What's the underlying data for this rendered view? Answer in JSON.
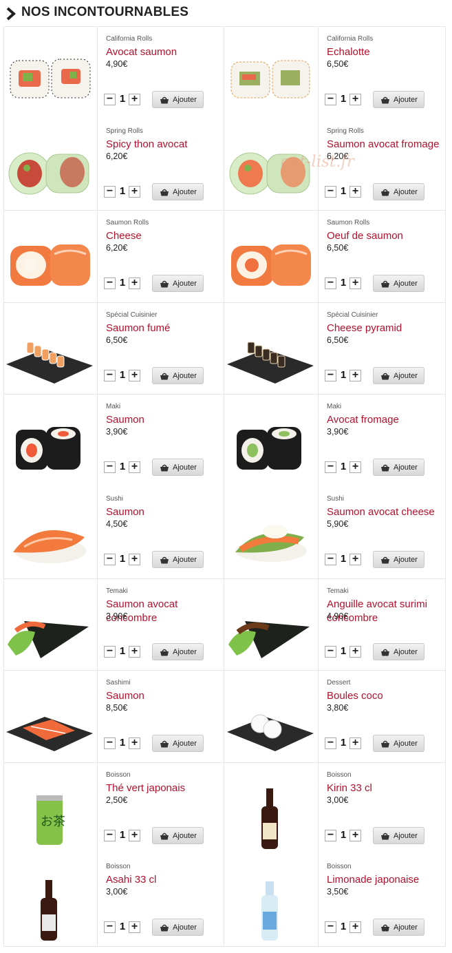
{
  "page": {
    "title": "NOS INCONTOURNABLES",
    "watermark": "eat-list.fr"
  },
  "add_label": "Ajouter",
  "products": [
    {
      "category": "California Rolls",
      "name": "Avocat saumon",
      "price": "4,90€",
      "qty": "1",
      "img": "california-roll-avocado-salmon"
    },
    {
      "category": "California Rolls",
      "name": "Echalotte",
      "price": "6,50€",
      "qty": "1",
      "img": "california-roll-shallot"
    },
    {
      "category": "Spring Rolls",
      "name": "Spicy thon avocat",
      "price": "6,20€",
      "qty": "1",
      "img": "spring-roll-tuna"
    },
    {
      "category": "Spring Rolls",
      "name": "Saumon avocat fromage",
      "price": "6,20€",
      "qty": "1",
      "img": "spring-roll-salmon"
    },
    {
      "category": "Saumon Rolls",
      "name": "Cheese",
      "price": "6,20€",
      "qty": "1",
      "img": "salmon-roll-cheese"
    },
    {
      "category": "Saumon Rolls",
      "name": "Oeuf de saumon",
      "price": "6,50€",
      "qty": "1",
      "img": "salmon-roll-roe"
    },
    {
      "category": "Spécial Cuisinier",
      "name": "Saumon fumé",
      "price": "6,50€",
      "qty": "1",
      "img": "plate-smoked-salmon-rolls"
    },
    {
      "category": "Spécial Cuisinier",
      "name": "Cheese pyramid",
      "price": "6,50€",
      "qty": "1",
      "img": "plate-cheese-pyramid"
    },
    {
      "category": "Maki",
      "name": "Saumon",
      "price": "3,90€",
      "qty": "1",
      "img": "maki-salmon"
    },
    {
      "category": "Maki",
      "name": "Avocat fromage",
      "price": "3,90€",
      "qty": "1",
      "img": "maki-avocado"
    },
    {
      "category": "Sushi",
      "name": "Saumon",
      "price": "4,50€",
      "qty": "1",
      "img": "sushi-salmon"
    },
    {
      "category": "Sushi",
      "name": "Saumon avocat cheese",
      "price": "5,90€",
      "qty": "1",
      "img": "sushi-salmon-avocado"
    },
    {
      "category": "Temaki",
      "name": "Saumon avocat concombre",
      "price": "3,90€",
      "qty": "1",
      "img": "temaki-salmon"
    },
    {
      "category": "Temaki",
      "name": "Anguille avocat surimi concombre",
      "price": "4,90€",
      "qty": "1",
      "img": "temaki-eel"
    },
    {
      "category": "Sashimi",
      "name": "Saumon",
      "price": "8,50€",
      "qty": "1",
      "img": "sashimi-salmon"
    },
    {
      "category": "Dessert",
      "name": "Boules coco",
      "price": "3,80€",
      "qty": "1",
      "img": "coconut-balls"
    },
    {
      "category": "Boisson",
      "name": "Thé vert japonais",
      "price": "2,50€",
      "qty": "1",
      "img": "green-tea-can"
    },
    {
      "category": "Boisson",
      "name": "Kirin 33 cl",
      "price": "3,00€",
      "qty": "1",
      "img": "kirin-bottle"
    },
    {
      "category": "Boisson",
      "name": "Asahi 33 cl",
      "price": "3,00€",
      "qty": "1",
      "img": "asahi-bottle"
    },
    {
      "category": "Boisson",
      "name": "Limonade japonaise",
      "price": "3,50€",
      "qty": "1",
      "img": "ramune-bottle"
    }
  ]
}
